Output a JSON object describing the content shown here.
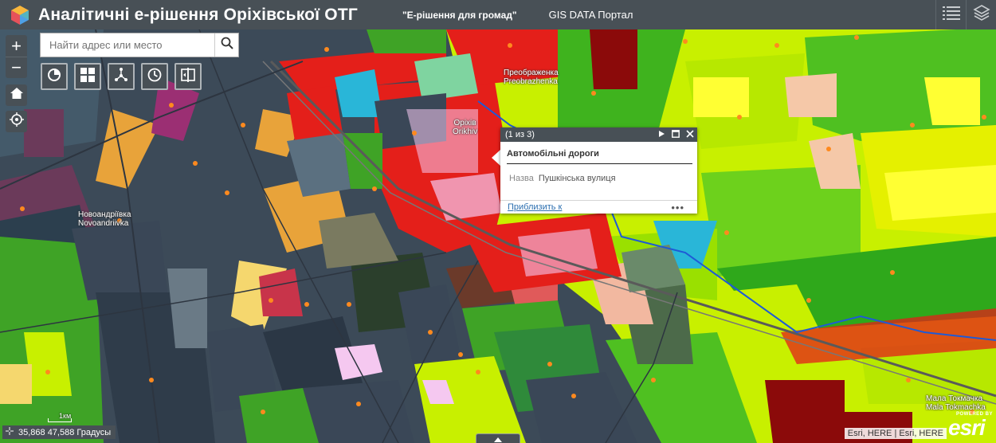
{
  "header": {
    "title": "Аналітичні е-рішення Оріхівської ОТГ",
    "link_one": "\"Е-рішення для громад\"",
    "link_two": "GIS DATA Портал"
  },
  "search": {
    "placeholder": "Найти адрес или место"
  },
  "map": {
    "labels": [
      {
        "id": "preobrazhenka",
        "text": "Преображенка\nPreobrazhenka"
      },
      {
        "id": "orikhiv",
        "text": "Оріхів\nOrikhiv"
      },
      {
        "id": "novoandriivka",
        "text": "Новоандріївка\nNovoandriivka"
      },
      {
        "id": "mala_tokmachka",
        "text": "Мала Токмачка\nMala Tokmachka"
      }
    ],
    "scale_label": "1км",
    "coordinates": "35,868 47,588 Градусы",
    "attribution": "Esri, HERE | Esri, HERE",
    "esri_powered": "POWERED BY",
    "esri_brand": "esri"
  },
  "popup": {
    "counter": "(1 из 3)",
    "layer_title": "Автомобільні дороги",
    "field_name": "Назва",
    "field_value": "Пушкінська вулиця",
    "zoom_link": "Приблизить к",
    "more": "•••"
  },
  "controls": {
    "zoom_in": "+",
    "zoom_out": "−"
  },
  "icons": {
    "logo": "cube-logo-icon",
    "list": "list-icon",
    "layers": "layers-icon",
    "search": "search-icon",
    "home": "home-icon",
    "locate": "locate-icon",
    "tools": [
      "chart-pie-icon",
      "grid-icon",
      "share-network-icon",
      "time-icon",
      "swipe-icon"
    ]
  },
  "colors": {
    "header_bg": "#485056",
    "accent_link": "#2c6fb0",
    "map_green": "#4fc021",
    "map_lime": "#c8f000",
    "map_red": "#e41f1a"
  }
}
